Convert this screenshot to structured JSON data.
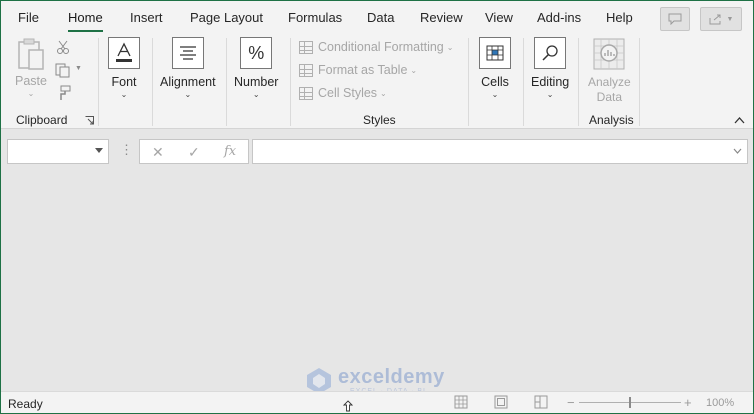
{
  "tabs": [
    {
      "label": "File",
      "active": false
    },
    {
      "label": "Home",
      "active": true
    },
    {
      "label": "Insert",
      "active": false
    },
    {
      "label": "Page Layout",
      "active": false
    },
    {
      "label": "Formulas",
      "active": false
    },
    {
      "label": "Data",
      "active": false
    },
    {
      "label": "Review",
      "active": false
    },
    {
      "label": "View",
      "active": false
    },
    {
      "label": "Add-ins",
      "active": false
    },
    {
      "label": "Help",
      "active": false
    }
  ],
  "ribbon": {
    "clipboard": {
      "paste_label": "Paste",
      "group_label": "Clipboard"
    },
    "font": {
      "label": "Font"
    },
    "alignment": {
      "label": "Alignment"
    },
    "number": {
      "label": "Number"
    },
    "styles": {
      "conditional_formatting": "Conditional Formatting",
      "format_as_table": "Format as Table",
      "cell_styles": "Cell Styles",
      "group_label": "Styles"
    },
    "cells": {
      "label": "Cells"
    },
    "editing": {
      "label": "Editing"
    },
    "analysis": {
      "analyze_label_1": "Analyze",
      "analyze_label_2": "Data",
      "group_label": "Analysis"
    }
  },
  "formula_bar": {
    "name_box_value": "",
    "cancel_glyph": "✕",
    "enter_glyph": "✓",
    "fx_glyph": "fx",
    "formula_value": ""
  },
  "status_bar": {
    "status": "Ready",
    "zoom_level": "100%",
    "zoom_minus": "−",
    "zoom_plus": "+"
  },
  "watermark": {
    "name": "exceldemy",
    "tagline": "EXCEL · DATA · BI"
  },
  "colors": {
    "accent": "#1e7145",
    "ribbon_bg": "#f3f3f3",
    "workspace_bg": "#e6e6e6"
  }
}
